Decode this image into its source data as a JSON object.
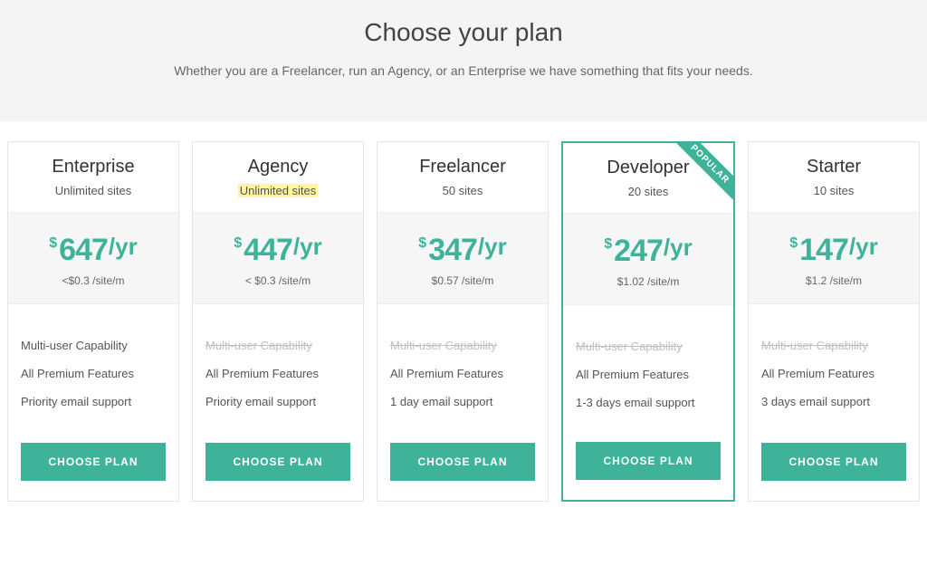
{
  "hero": {
    "title": "Choose your plan",
    "subtitle": "Whether you are a Freelancer, run an Agency, or an Enterprise we have something that fits your needs."
  },
  "popular_label": "POPULAR",
  "cta_label": "CHOOSE PLAN",
  "currency": "$",
  "period": "/yr",
  "plans": [
    {
      "name": "Enterprise",
      "sites": "Unlimited sites",
      "highlight_sites": false,
      "popular": false,
      "amount": "647",
      "subprice": "<$0.3 /site/m",
      "features": [
        {
          "label": "Multi-user Capability",
          "enabled": true
        },
        {
          "label": "All Premium Features",
          "enabled": true
        },
        {
          "label": "Priority email support",
          "enabled": true
        }
      ]
    },
    {
      "name": "Agency",
      "sites": "Unlimited sites",
      "highlight_sites": true,
      "popular": false,
      "amount": "447",
      "subprice": "< $0.3 /site/m",
      "features": [
        {
          "label": "Multi-user Capability",
          "enabled": false
        },
        {
          "label": "All Premium Features",
          "enabled": true
        },
        {
          "label": "Priority email support",
          "enabled": true
        }
      ]
    },
    {
      "name": "Freelancer",
      "sites": "50 sites",
      "highlight_sites": false,
      "popular": false,
      "amount": "347",
      "subprice": "$0.57 /site/m",
      "features": [
        {
          "label": "Multi-user Capability",
          "enabled": false
        },
        {
          "label": "All Premium Features",
          "enabled": true
        },
        {
          "label": "1 day email support",
          "enabled": true
        }
      ]
    },
    {
      "name": "Developer",
      "sites": "20 sites",
      "highlight_sites": false,
      "popular": true,
      "amount": "247",
      "subprice": "$1.02 /site/m",
      "features": [
        {
          "label": "Multi-user Capability",
          "enabled": false
        },
        {
          "label": "All Premium Features",
          "enabled": true
        },
        {
          "label": "1-3 days email support",
          "enabled": true
        }
      ]
    },
    {
      "name": "Starter",
      "sites": "10 sites",
      "highlight_sites": false,
      "popular": false,
      "amount": "147",
      "subprice": "$1.2 /site/m",
      "features": [
        {
          "label": "Multi-user Capability",
          "enabled": false
        },
        {
          "label": "All Premium Features",
          "enabled": true
        },
        {
          "label": "3 days email support",
          "enabled": true
        }
      ]
    }
  ]
}
